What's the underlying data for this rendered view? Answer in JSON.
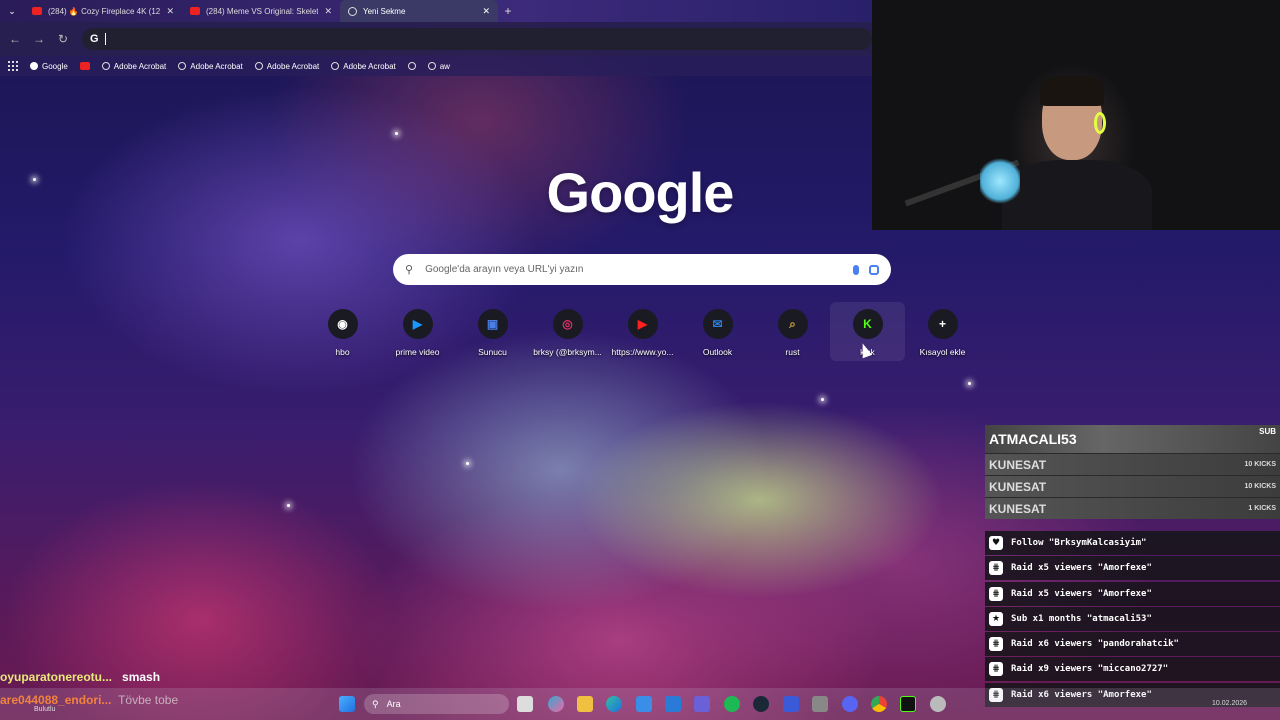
{
  "tabs": [
    {
      "title": "(284) 🔥 Cozy Fireplace 4K (12",
      "type": "youtube"
    },
    {
      "title": "(284) Meme VS Original: Skelet",
      "type": "youtube"
    },
    {
      "title": "Yeni Sekme",
      "type": "globe",
      "active": true
    }
  ],
  "omnibox": {
    "value": ""
  },
  "bookmarks": [
    {
      "label": "Google",
      "icon": "google-icon"
    },
    {
      "label": "",
      "icon": "youtube-icon"
    },
    {
      "label": "Adobe Acrobat",
      "icon": "globe-icon"
    },
    {
      "label": "Adobe Acrobat",
      "icon": "globe-icon"
    },
    {
      "label": "Adobe Acrobat",
      "icon": "globe-icon"
    },
    {
      "label": "Adobe Acrobat",
      "icon": "globe-icon"
    },
    {
      "label": "",
      "icon": "globe-icon"
    },
    {
      "label": "aw",
      "icon": "app-icon"
    }
  ],
  "ntp": {
    "logo": "Google",
    "search_placeholder": "Google'da arayın veya URL'yi yazın",
    "shortcuts": [
      {
        "label": "hbo",
        "glyph": "◉",
        "color": "#ffffff"
      },
      {
        "label": "prime video",
        "glyph": "▶",
        "color": "#1a98ff"
      },
      {
        "label": "Sunucu",
        "glyph": "▣",
        "color": "#4a7fe8"
      },
      {
        "label": "brksy (@brksym...",
        "glyph": "◎",
        "color": "#e1306c"
      },
      {
        "label": "https://www.yo...",
        "glyph": "▶",
        "color": "#ff2020"
      },
      {
        "label": "Outlook",
        "glyph": "✉",
        "color": "#2a7bd8"
      },
      {
        "label": "rust",
        "glyph": "⌕",
        "color": "#c8a040"
      },
      {
        "label": "kick",
        "glyph": "K",
        "color": "#53fc18"
      },
      {
        "label": "Kısayol ekle",
        "glyph": "+",
        "color": "#ffffff"
      }
    ]
  },
  "alerts": {
    "top": {
      "name": "ATMACALI53",
      "tag": "SUB"
    },
    "rows": [
      {
        "name": "KUNESAT",
        "tag": "10 KICKS"
      },
      {
        "name": "KUNESAT",
        "tag": "10 KICKS"
      },
      {
        "name": "KUNESAT",
        "tag": "1 KICKS"
      }
    ]
  },
  "events": [
    {
      "icon": "♥",
      "text": "Follow \"BrksymKalcasiyim\""
    },
    {
      "icon": "⋕",
      "text": "Raid x5 viewers \"Amorfexe\""
    },
    {
      "icon": "⋕",
      "text": "Raid x5 viewers \"Amorfexe\""
    },
    {
      "icon": "★",
      "text": "Sub x1 months \"atmacali53\""
    },
    {
      "icon": "⋕",
      "text": "Raid x6 viewers \"pandorahatcik\""
    },
    {
      "icon": "⋕",
      "text": "Raid x9 viewers \"miccano2727\""
    },
    {
      "icon": "⋕",
      "text": "Raid x6 viewers \"Amorfexe\""
    }
  ],
  "chat": [
    {
      "user": "oyuparatonereotu...",
      "message": "smash"
    },
    {
      "user": "are044088_endori...",
      "message": "Tövbe tobe"
    }
  ],
  "taskbar": {
    "search_label": "Ara",
    "weather": "Bulutlu",
    "date": "10.02.2026"
  }
}
